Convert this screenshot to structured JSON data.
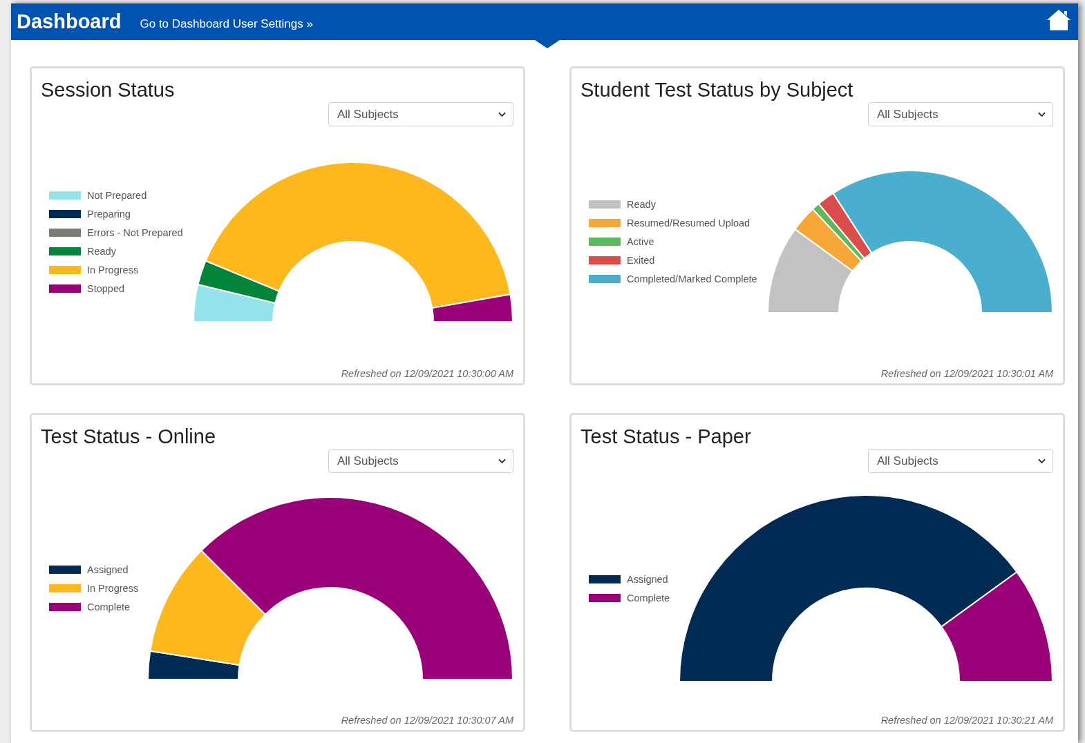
{
  "header": {
    "title": "Dashboard",
    "settings_link": "Go to Dashboard User Settings »"
  },
  "panels": [
    {
      "title": "Session Status",
      "filter": {
        "value": "All Subjects"
      },
      "legend": [
        {
          "label": "Not Prepared",
          "color": "#94e3ea"
        },
        {
          "label": "Preparing",
          "color": "#012b54"
        },
        {
          "label": "Errors - Not Prepared",
          "color": "#7b7d77"
        },
        {
          "label": "Ready",
          "color": "#02853a"
        },
        {
          "label": "In Progress",
          "color": "#fdb81e"
        },
        {
          "label": "Stopped",
          "color": "#9a0078"
        }
      ],
      "refreshed": "Refreshed on 12/09/2021 10:30:00 AM"
    },
    {
      "title": "Student Test Status by Subject",
      "filter": {
        "value": "All Subjects"
      },
      "legend": [
        {
          "label": "Ready",
          "color": "#c2c2c2"
        },
        {
          "label": "Resumed/Resumed Upload",
          "color": "#f7a737"
        },
        {
          "label": "Active",
          "color": "#5cb85c"
        },
        {
          "label": "Exited",
          "color": "#db4d4a"
        },
        {
          "label": "Completed/Marked Complete",
          "color": "#4aafcf"
        }
      ],
      "refreshed": "Refreshed on 12/09/2021 10:30:01 AM"
    },
    {
      "title": "Test Status - Online",
      "filter": {
        "value": "All Subjects"
      },
      "legend": [
        {
          "label": "Assigned",
          "color": "#012b54"
        },
        {
          "label": "In Progress",
          "color": "#fdb81e"
        },
        {
          "label": "Complete",
          "color": "#9a0078"
        }
      ],
      "refreshed": "Refreshed on 12/09/2021 10:30:07 AM"
    },
    {
      "title": "Test Status - Paper",
      "filter": {
        "value": "All Subjects"
      },
      "legend": [
        {
          "label": "Assigned",
          "color": "#012b54"
        },
        {
          "label": "Complete",
          "color": "#9a0078"
        }
      ],
      "refreshed": "Refreshed on 12/09/2021 10:30:21 AM"
    }
  ]
}
